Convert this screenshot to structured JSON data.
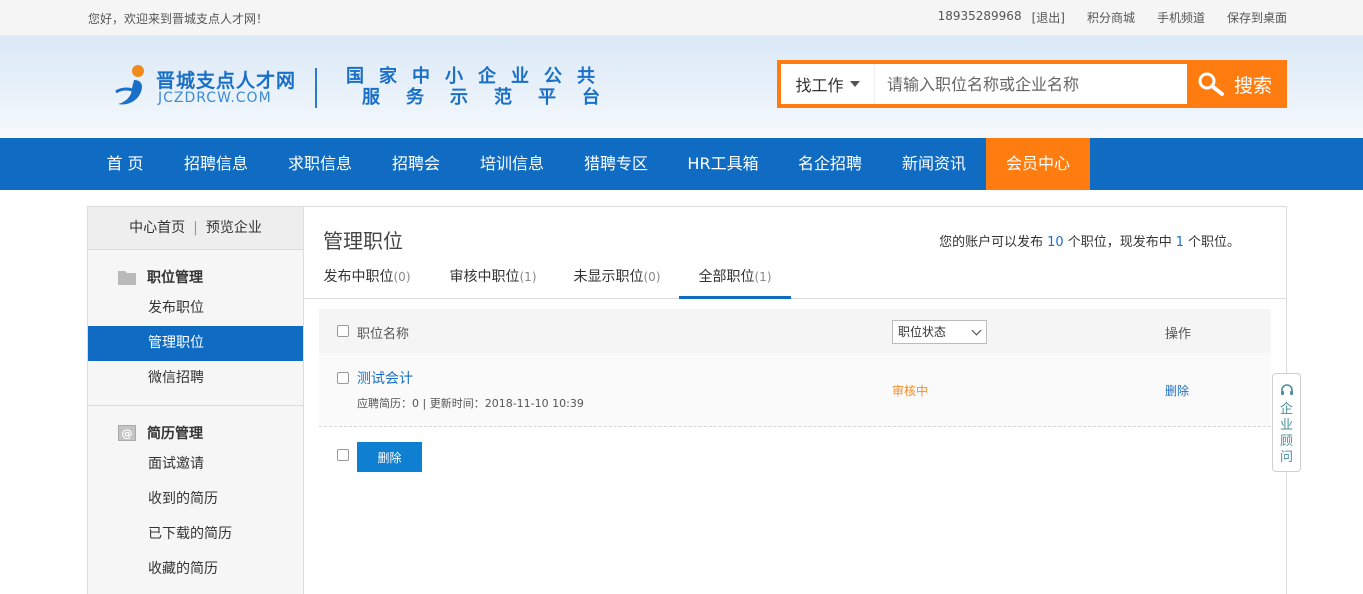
{
  "topbar": {
    "welcome": "您好，欢迎来到晋城支点人才网！",
    "phone": "18935289968",
    "logout": "[退出]",
    "points_mall": "积分商城",
    "mobile": "手机频道",
    "save_desktop": "保存到桌面"
  },
  "header": {
    "logo_name": "晋城支点人才网",
    "logo_domain": "JCZDRCW.COM",
    "slogan_line1": "国家中小企业公共",
    "slogan_line2": "服务示范平台"
  },
  "search": {
    "type": "找工作",
    "placeholder": "请输入职位名称或企业名称",
    "button": "搜索"
  },
  "nav": {
    "items": [
      "首 页",
      "招聘信息",
      "求职信息",
      "招聘会",
      "培训信息",
      "猎聘专区",
      "HR工具箱",
      "名企招聘",
      "新闻资讯",
      "会员中心"
    ],
    "active": "会员中心"
  },
  "sidebar": {
    "home": "中心首页",
    "preview": "预览企业",
    "group1": {
      "title": "职位管理",
      "items": [
        "发布职位",
        "管理职位",
        "微信招聘"
      ]
    },
    "group2": {
      "title": "简历管理",
      "items": [
        "面试邀请",
        "收到的简历",
        "已下载的简历",
        "收藏的简历"
      ]
    },
    "active_item": "管理职位"
  },
  "content": {
    "title": "管理职位",
    "quota_prefix": "您的账户可以发布",
    "quota_total": "10",
    "quota_mid": "个职位，现发布中",
    "quota_current": "1",
    "quota_suffix": "个职位。",
    "tabs": [
      {
        "label": "发布中职位",
        "count": "(0)"
      },
      {
        "label": "审核中职位",
        "count": "(1)"
      },
      {
        "label": "未显示职位",
        "count": "(0)"
      },
      {
        "label": "全部职位",
        "count": "(1)"
      }
    ],
    "active_tab": "全部职位"
  },
  "table": {
    "col_name": "职位名称",
    "col_status": "职位状态",
    "col_op": "操作",
    "rows": [
      {
        "name": "测试会计",
        "meta": "应聘简历：0 | 更新时间：2018-11-10 10:39",
        "status": "审核中",
        "op": "删除"
      }
    ],
    "delete_button": "删除"
  },
  "adviser": {
    "label": "企业顾问"
  },
  "colors": {
    "primary_blue": "#0f6cc2",
    "accent_orange": "#ff7c10",
    "status_orange": "#ff8a1e",
    "link_blue": "#1a6fc7"
  }
}
